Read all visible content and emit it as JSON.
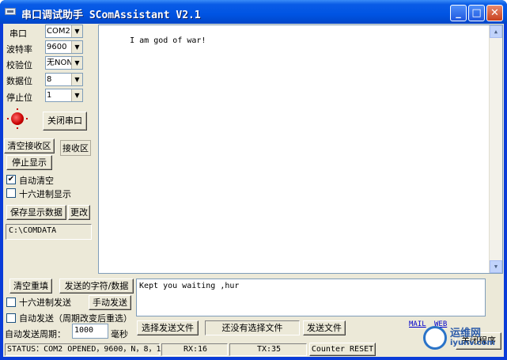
{
  "window": {
    "title": "串口调试助手  SComAssistant V2.1"
  },
  "port": {
    "port_label": "串口",
    "port_value": "COM2",
    "baud_label": "波特率",
    "baud_value": "9600",
    "parity_label": "校验位",
    "parity_value": "无NON",
    "databits_label": "数据位",
    "databits_value": "8",
    "stopbits_label": "停止位",
    "stopbits_value": "1",
    "toggle_label": "关闭串口",
    "led_color": "#c80000"
  },
  "receive": {
    "clear_label": "清空接收区",
    "area_label": "接收区",
    "stop_label": "停止显示",
    "auto_clear_label": "自动清空",
    "auto_clear_checked": "✔",
    "hex_label": "十六进制显示",
    "save_label": "保存显示数据",
    "change_label": "更改",
    "path": "C:\\COMDATA",
    "content": "I am god of war!"
  },
  "send": {
    "clear_label": "清空重填",
    "chars_label": "发送的字符/数据",
    "hex_label": "十六进制发送",
    "manual_label": "手动发送",
    "auto_label": "自动发送（周期改变后重选）",
    "period_label": "自动发送周期：",
    "period_value": "1000",
    "period_unit": "毫秒",
    "select_file_label": "选择发送文件",
    "file_status": "还没有选择文件",
    "send_file_label": "发送文件",
    "content": "Kept you waiting ,hur"
  },
  "links": {
    "mail": "MAIL",
    "web": "WEB"
  },
  "close_program_label": "关闭程序",
  "status": {
    "status_text": "STATUS：COM2 OPENED，9600，N，8，1",
    "rx": "RX:16",
    "tx": "TX:35",
    "counter_reset": "Counter RESET"
  },
  "watermark": {
    "text": "运维网",
    "url": "iyunv.com"
  }
}
